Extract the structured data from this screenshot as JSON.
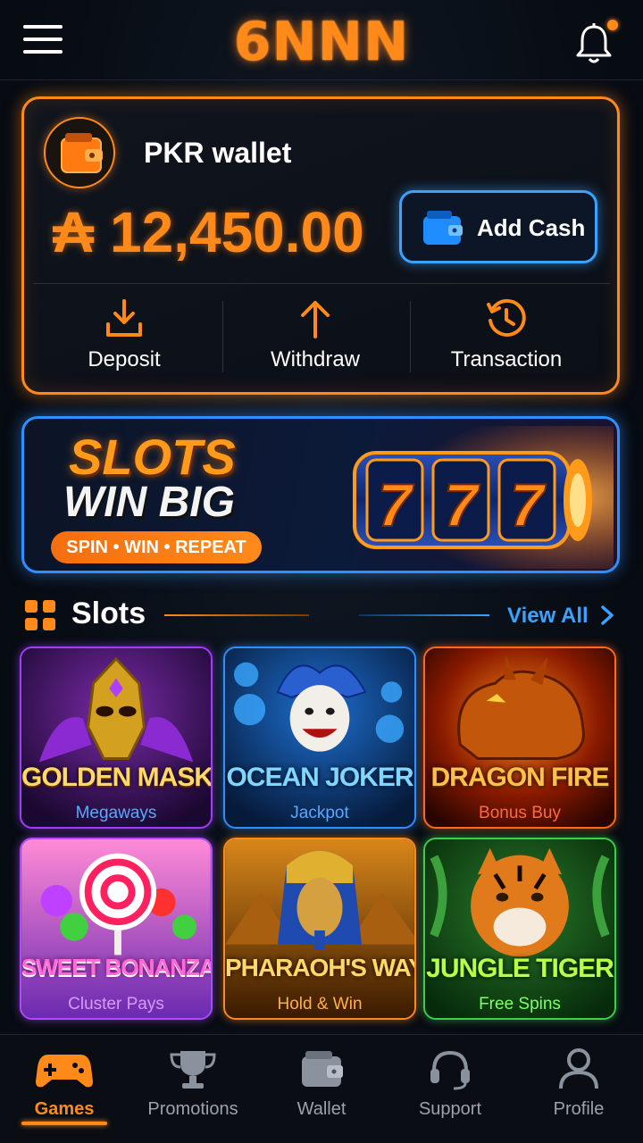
{
  "header": {
    "logo": "6NNN",
    "menu_icon": "hamburger-menu-icon",
    "notification_icon": "bell-icon",
    "has_notification": true
  },
  "wallet": {
    "title": "PKR wallet",
    "balance": "₳ 12,450.00",
    "add_cash_label": "Add Cash",
    "actions": [
      {
        "label": "Deposit",
        "icon": "download-icon"
      },
      {
        "label": "Withdraw",
        "icon": "arrow-up-icon"
      },
      {
        "label": "Transaction",
        "icon": "history-clock-icon"
      }
    ]
  },
  "banner": {
    "line1": "SLOTS",
    "line2": "WIN BIG",
    "tagline": "SPIN • WIN • REPEAT",
    "reel_digits": [
      "7",
      "7",
      "7"
    ]
  },
  "section": {
    "title": "Slots",
    "view_all": "View All"
  },
  "games": [
    {
      "title": "GOLDEN MASK",
      "subtitle": "Megaways",
      "accent": "#a23cff",
      "sub_color": "#5aa8ff"
    },
    {
      "title": "OCEAN JOKER",
      "subtitle": "Jackpot",
      "accent": "#2f8fff",
      "sub_color": "#5aa8ff"
    },
    {
      "title": "DRAGON FIRE",
      "subtitle": "Bonus Buy",
      "accent": "#ff6a1a",
      "sub_color": "#ff6a3a"
    },
    {
      "title": "SWEET BONANZA",
      "subtitle": "Cluster Pays",
      "accent": "#b04cff",
      "sub_color": "#d59aff"
    },
    {
      "title": "PHARAOH'S WAY",
      "subtitle": "Hold & Win",
      "accent": "#ff8a1a",
      "sub_color": "#ffb04a"
    },
    {
      "title": "JUNGLE TIGER",
      "subtitle": "Free Spins",
      "accent": "#3ccf4a",
      "sub_color": "#7cff6a"
    }
  ],
  "nav": [
    {
      "label": "Games",
      "icon": "gamepad-icon",
      "active": true
    },
    {
      "label": "Promotions",
      "icon": "trophy-icon",
      "active": false
    },
    {
      "label": "Wallet",
      "icon": "wallet-icon",
      "active": false
    },
    {
      "label": "Support",
      "icon": "headset-icon",
      "active": false
    },
    {
      "label": "Profile",
      "icon": "user-icon",
      "active": false
    }
  ],
  "colors": {
    "accent_orange": "#ff8a1a",
    "accent_blue": "#2f8fff",
    "background": "#070b12"
  }
}
